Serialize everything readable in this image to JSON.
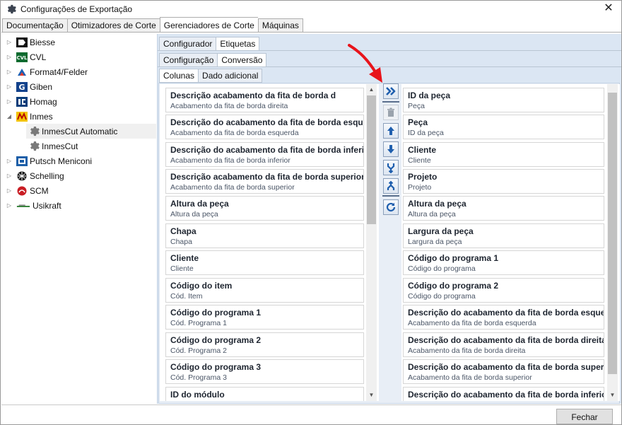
{
  "window": {
    "title": "Configurações de Exportação",
    "close_glyph": "✕"
  },
  "main_tabs": [
    "Documentação",
    "Otimizadores de Corte",
    "Gerenciadores de Corte",
    "Máquinas"
  ],
  "main_tabs_active": 2,
  "tree": [
    {
      "label": "Biesse",
      "icon": "biesse-logo",
      "expanded": false,
      "level": 0
    },
    {
      "label": "CVL",
      "icon": "cvl-logo",
      "expanded": false,
      "level": 0
    },
    {
      "label": "Format4/Felder",
      "icon": "format4-logo",
      "expanded": false,
      "level": 0
    },
    {
      "label": "Giben",
      "icon": "giben-logo",
      "expanded": false,
      "level": 0
    },
    {
      "label": "Homag",
      "icon": "homag-logo",
      "expanded": false,
      "level": 0
    },
    {
      "label": "Inmes",
      "icon": "inmes-logo",
      "expanded": true,
      "level": 0
    },
    {
      "label": "InmesCut Automatic",
      "icon": "gear-icon",
      "level": 1,
      "selected": true
    },
    {
      "label": "InmesCut",
      "icon": "gear-icon",
      "level": 1
    },
    {
      "label": "Putsch Meniconi",
      "icon": "putsch-logo",
      "expanded": false,
      "level": 0
    },
    {
      "label": "Schelling",
      "icon": "schelling-logo",
      "expanded": false,
      "level": 0
    },
    {
      "label": "SCM",
      "icon": "scm-logo",
      "expanded": false,
      "level": 0
    },
    {
      "label": "Usikraft",
      "icon": "usikraft-logo",
      "expanded": false,
      "level": 0
    }
  ],
  "sub_tabs_1": [
    "Configurador",
    "Etiquetas"
  ],
  "sub_tabs_2": [
    "Configuração",
    "Conversão"
  ],
  "sub_tabs_3": [
    "Colunas",
    "Dado adicional"
  ],
  "available_columns": [
    {
      "title": "Descrição acabamento da fita de borda d",
      "subtitle": "Acabamento da fita de borda direita"
    },
    {
      "title": "Descrição do acabamento da fita de borda esquerda",
      "subtitle": "Acabamento da fita de borda esquerda"
    },
    {
      "title": "Descrição do acabamento da fita de borda inferior",
      "subtitle": "Acabamento da fita de borda inferior"
    },
    {
      "title": "Descrição acabamento da fita de borda superior",
      "subtitle": "Acabamento da fita de borda superior"
    },
    {
      "title": "Altura da peça",
      "subtitle": "Altura da peça"
    },
    {
      "title": "Chapa",
      "subtitle": "Chapa"
    },
    {
      "title": "Cliente",
      "subtitle": "Cliente"
    },
    {
      "title": "Código do item",
      "subtitle": "Cód. Item"
    },
    {
      "title": "Código do programa 1",
      "subtitle": "Cód. Programa 1"
    },
    {
      "title": "Código do programa 2",
      "subtitle": "Cód. Programa 2"
    },
    {
      "title": "Código do programa 3",
      "subtitle": "Cód. Programa 3"
    },
    {
      "title": "ID do módulo",
      "subtitle": ""
    }
  ],
  "selected_columns": [
    {
      "title": "ID da peça",
      "subtitle": "Peça"
    },
    {
      "title": "Peça",
      "subtitle": "ID da peça"
    },
    {
      "title": "Cliente",
      "subtitle": "Cliente"
    },
    {
      "title": "Projeto",
      "subtitle": "Projeto"
    },
    {
      "title": "Altura da peça",
      "subtitle": "Altura da peça"
    },
    {
      "title": "Largura da peça",
      "subtitle": "Largura da peça"
    },
    {
      "title": "Código do programa 1",
      "subtitle": "Código do programa"
    },
    {
      "title": "Código do programa 2",
      "subtitle": "Código do programa"
    },
    {
      "title": "Descrição do acabamento da fita de borda esquerda",
      "subtitle": "Acabamento da fita de borda esquerda"
    },
    {
      "title": "Descrição do acabamento da fita de borda direita",
      "subtitle": "Acabamento da fita de borda direita"
    },
    {
      "title": "Descrição do acabamento da fita de borda superior",
      "subtitle": "Acabamento da fita de borda superior"
    },
    {
      "title": "Descrição do acabamento da fita de borda inferior",
      "subtitle": ""
    }
  ],
  "toolbar_icons": [
    "move-right-icon",
    "delete-icon",
    "move-up-icon",
    "move-down-icon",
    "merge-icon",
    "split-icon",
    "refresh-icon"
  ],
  "footer": {
    "close_label": "Fechar"
  },
  "colors": {
    "accent_blue": "#1f5fae",
    "pane_bg": "#dbe6f3",
    "annotation_red": "#e8141b"
  }
}
